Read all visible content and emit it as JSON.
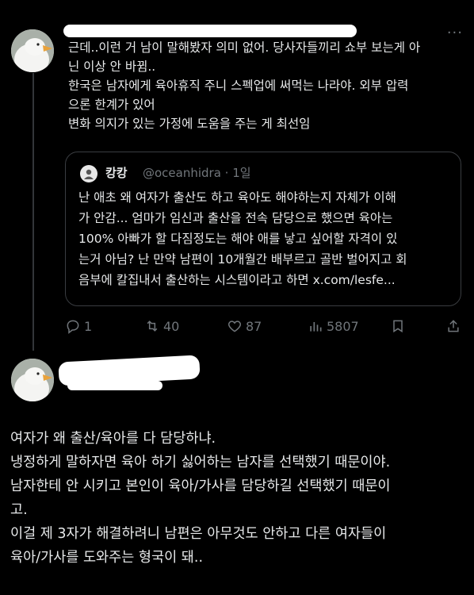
{
  "tweet1": {
    "lines": [
      "근데..이런 거 남이 말해봤자 의미 없어. 당사자들끼리 쇼부 보는게 아",
      "닌 이상 안 바뀜..",
      "한국은 남자에게 육아휴직 주니 스펙업에 써먹는 나라야. 외부 압력",
      "으론 한계가 있어",
      "변화 의지가 있는 가정에 도움을 주는 게 최선임"
    ],
    "more_label": "···"
  },
  "quote": {
    "name": "캉캉",
    "handle": "@oceanhidra · 1일",
    "lines": [
      "난 애초 왜 여자가 출산도 하고 육아도 해야하는지 자체가 이해",
      "가 안감... 엄마가 임신과 출산을 전속 담당으로 했으면 육아는",
      "100% 아빠가 할 다짐정도는 해야 애를 낳고 싶어할 자격이 있",
      "는거 아님? 난 만약 남편이 10개월간 배부르고 골반 벌어지고 회",
      "음부에 칼집내서 출산하는 시스템이라고 하면 x.com/lesfe..."
    ]
  },
  "actions": {
    "replies": "1",
    "reposts": "40",
    "likes": "87",
    "views": "5807"
  },
  "tweet2": {
    "lines": [
      "여자가 왜 출산/육아를 다 담당하냐.",
      "냉정하게 말하자면 육아 하기 싫어하는 남자를 선택했기 때문이야.",
      "남자한테 안 시키고 본인이 육아/가사를 담당하길 선택했기 때문이",
      "고.",
      "이걸 제 3자가 해결하려니 남편은 아무것도 안하고 다른 여자들이",
      "육아/가사를 도와주는 형국이 돼.."
    ]
  },
  "icons": {
    "reply": "reply-icon",
    "repost": "repost-icon",
    "like": "heart-icon",
    "views": "views-icon",
    "bookmark": "bookmark-icon",
    "share": "share-icon"
  }
}
